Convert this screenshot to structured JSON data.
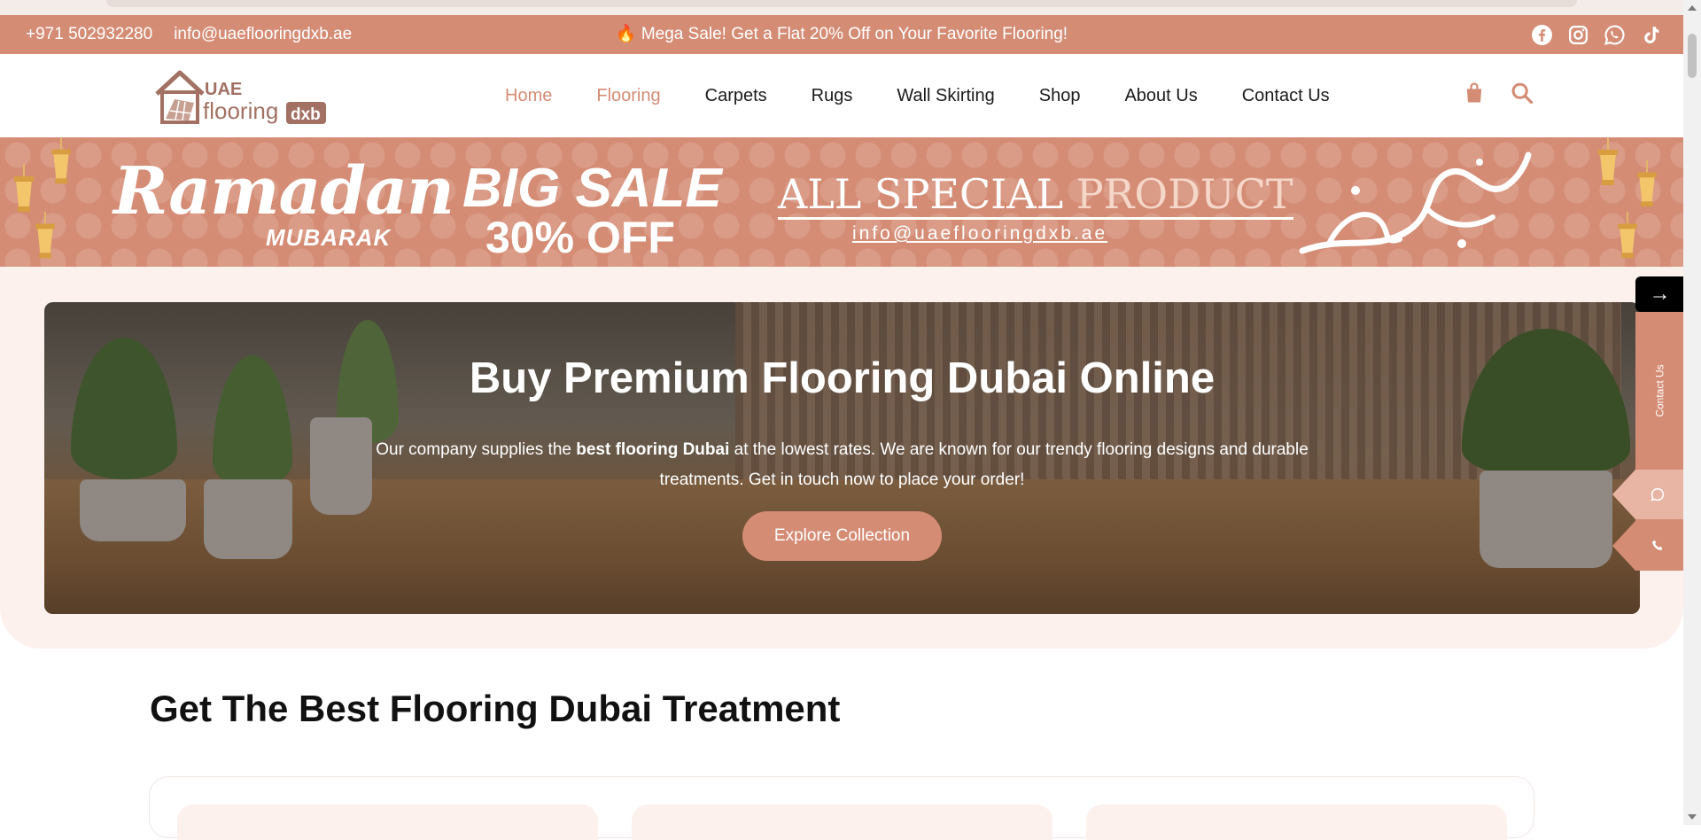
{
  "colors": {
    "brand": "#d48c75",
    "hero_bg": "#fdf1ee"
  },
  "topbar": {
    "phone": "+971 502932280",
    "email": "info@uaeflooringdxb.ae",
    "promo": "🔥 Mega Sale! Get a Flat 20% Off on Your Favorite Flooring!",
    "social_icons": [
      "facebook-icon",
      "instagram-icon",
      "whatsapp-icon",
      "tiktok-icon"
    ]
  },
  "logo": {
    "top": "UAE",
    "main": "flooring",
    "badge": "dxb"
  },
  "nav": [
    "Home",
    "Flooring",
    "Carpets",
    "Rugs",
    "Wall Skirting",
    "Shop",
    "About Us",
    "Contact Us"
  ],
  "header_icons": [
    "cart-icon",
    "search-icon"
  ],
  "banner": {
    "title": "Ramadan",
    "subtitle": "MUBARAK",
    "sale_line1": "BIG SALE",
    "sale_line2": "30% OFF",
    "special_a": "ALL SPECIAL ",
    "special_b": "PRODUCT",
    "email": "info@uaeflooringdxb.ae"
  },
  "hero": {
    "title": "Buy Premium Flooring Dubai Online",
    "text_before": "Our company supplies the ",
    "text_bold": "best flooring Dubai",
    "text_after": " at the lowest rates. We are known for our trendy flooring designs and durable treatments. Get in touch now to place your order!",
    "cta": "Explore Collection"
  },
  "side_widget": {
    "arrow": "→",
    "contact": "Contact Us"
  },
  "section": {
    "title": "Get The Best Flooring Dubai Treatment"
  }
}
